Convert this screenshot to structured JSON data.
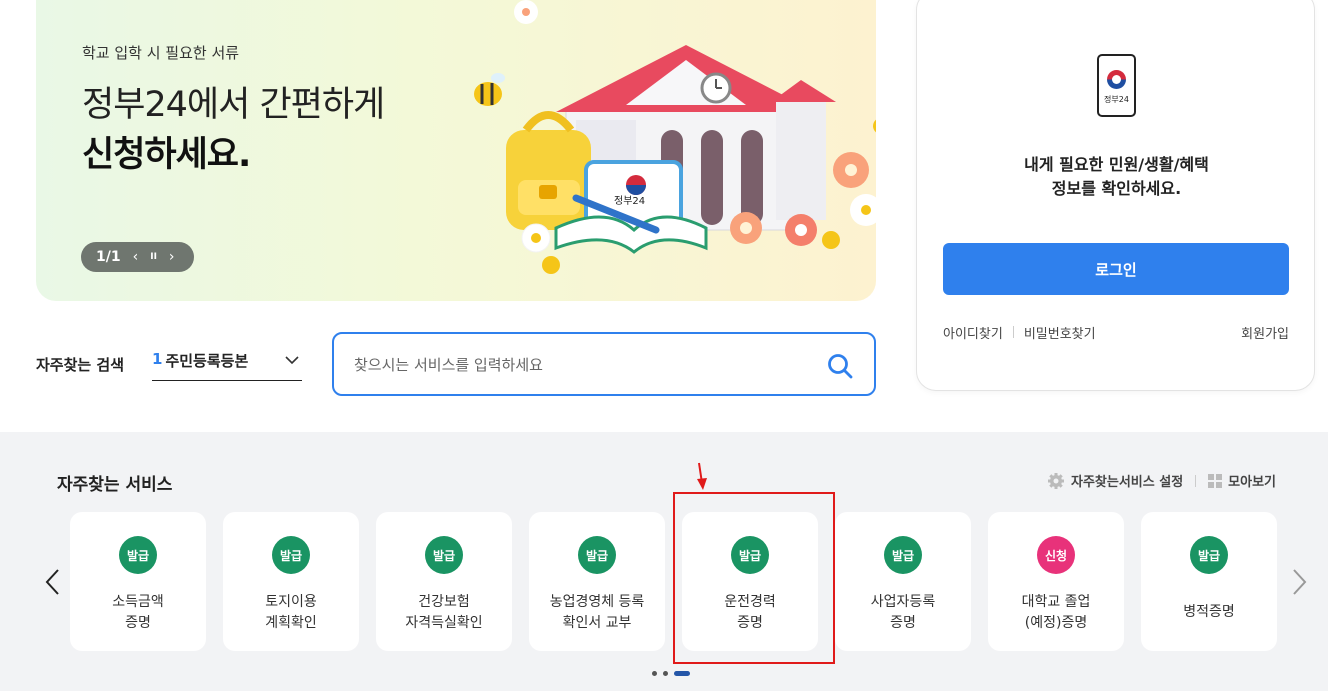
{
  "banner": {
    "subtitle": "학교 입학 시 필요한 서류",
    "title_line1": "정부24에서 간편하게",
    "title_line2": "신청하세요.",
    "pager_text": "1/1",
    "prev_icon": "‹",
    "pause_icon": "II",
    "next_icon": "›",
    "book_label": "정부24"
  },
  "login": {
    "app_label": "정부24",
    "message_line1": "내게 필요한 민원/생활/혜택",
    "message_line2": "정보를 확인하세요.",
    "button_label": "로그인",
    "find_id": "아이디찾기",
    "find_pw": "비밀번호찾기",
    "signup": "회원가입"
  },
  "frequent_search": {
    "label": "자주찾는 검색",
    "rank": "1",
    "selected": "주민등록등본",
    "placeholder": "찾으시는 서비스를 입력하세요"
  },
  "services": {
    "title": "자주찾는 서비스",
    "settings_label": "자주찾는서비스 설정",
    "view_all_label": "모아보기",
    "cards": [
      {
        "badge": "발급",
        "line1": "소득금액",
        "line2": "증명",
        "color": "#1a9463"
      },
      {
        "badge": "발급",
        "line1": "토지이용",
        "line2": "계획확인",
        "color": "#1a9463"
      },
      {
        "badge": "발급",
        "line1": "건강보험",
        "line2": "자격득실확인",
        "color": "#1a9463"
      },
      {
        "badge": "발급",
        "line1": "농업경영체 등록",
        "line2": "확인서 교부",
        "color": "#1a9463"
      },
      {
        "badge": "발급",
        "line1": "운전경력",
        "line2": "증명",
        "color": "#1a9463"
      },
      {
        "badge": "발급",
        "line1": "사업자등록",
        "line2": "증명",
        "color": "#1a9463"
      },
      {
        "badge": "신청",
        "line1": "대학교 졸업",
        "line2": "(예정)증명",
        "color": "#e8327a"
      },
      {
        "badge": "발급",
        "line1": "병적증명",
        "line2": "",
        "color": "#1a9463"
      }
    ]
  },
  "colors": {
    "accent": "#2f80ed",
    "issue_badge": "#1a9463",
    "apply_badge": "#e8327a",
    "highlight": "#e01a1a"
  }
}
